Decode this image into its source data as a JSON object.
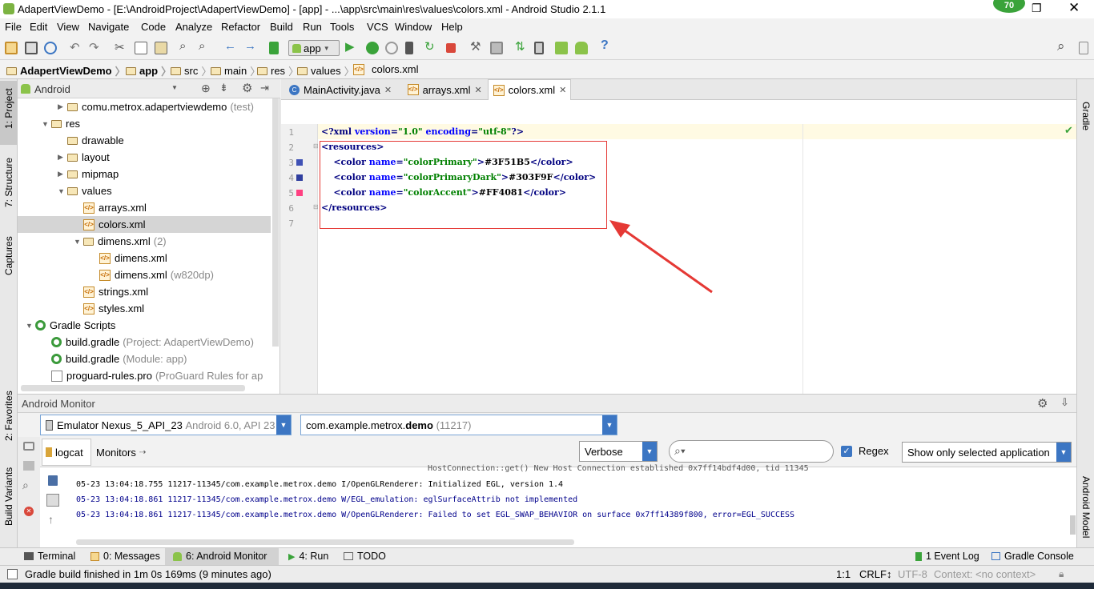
{
  "titlebar": {
    "title": "AdapertViewDemo - [E:\\AndroidProject\\AdapertViewDemo] - [app] - ...\\app\\src\\main\\res\\values\\colors.xml - Android Studio 2.1.1",
    "badge": "70"
  },
  "menu": [
    "File",
    "Edit",
    "View",
    "Navigate",
    "Code",
    "Analyze",
    "Refactor",
    "Build",
    "Run",
    "Tools",
    "VCS",
    "Window",
    "Help"
  ],
  "toolbar": {
    "run_config": "app"
  },
  "breadcrumb": [
    "AdapertViewDemo",
    "app",
    "src",
    "main",
    "res",
    "values",
    "colors.xml"
  ],
  "left_strip": {
    "project": "1: Project",
    "structure": "7: Structure",
    "captures": "Captures",
    "favorites": "2: Favorites",
    "build_variants": "Build Variants"
  },
  "right_strip": {
    "gradle": "Gradle",
    "android_model": "Android Model"
  },
  "project_panel": {
    "view_selector": "Android",
    "tree": [
      {
        "label": "comu.metrox.adapertviewdemo",
        "extra": "(test)",
        "kind": "package",
        "indent": 1,
        "arrow": "right"
      },
      {
        "label": "res",
        "extra": "",
        "kind": "folder",
        "indent": 0,
        "arrow": "down"
      },
      {
        "label": "drawable",
        "extra": "",
        "kind": "folder",
        "indent": 1,
        "arrow": ""
      },
      {
        "label": "layout",
        "extra": "",
        "kind": "folder",
        "indent": 1,
        "arrow": "right"
      },
      {
        "label": "mipmap",
        "extra": "",
        "kind": "folder",
        "indent": 1,
        "arrow": "right"
      },
      {
        "label": "values",
        "extra": "",
        "kind": "folder",
        "indent": 1,
        "arrow": "down"
      },
      {
        "label": "arrays.xml",
        "extra": "",
        "kind": "xml",
        "indent": 2,
        "arrow": ""
      },
      {
        "label": "colors.xml",
        "extra": "",
        "kind": "xml",
        "indent": 2,
        "arrow": "",
        "selected": true
      },
      {
        "label": "dimens.xml",
        "extra": "(2)",
        "kind": "folder",
        "indent": 2,
        "arrow": "down"
      },
      {
        "label": "dimens.xml",
        "extra": "",
        "kind": "xml",
        "indent": 3,
        "arrow": ""
      },
      {
        "label": "dimens.xml",
        "extra": "(w820dp)",
        "kind": "xml",
        "indent": 3,
        "arrow": ""
      },
      {
        "label": "strings.xml",
        "extra": "",
        "kind": "xml",
        "indent": 2,
        "arrow": ""
      },
      {
        "label": "styles.xml",
        "extra": "",
        "kind": "xml",
        "indent": 2,
        "arrow": ""
      },
      {
        "label": "Gradle Scripts",
        "extra": "",
        "kind": "gradle",
        "indent": -1,
        "arrow": "down"
      },
      {
        "label": "build.gradle",
        "extra": "(Project: AdapertViewDemo)",
        "kind": "gradle",
        "indent": 0,
        "arrow": ""
      },
      {
        "label": "build.gradle",
        "extra": "(Module: app)",
        "kind": "gradle",
        "indent": 0,
        "arrow": ""
      },
      {
        "label": "proguard-rules.pro",
        "extra": "(ProGuard Rules for ap",
        "kind": "file",
        "indent": 0,
        "arrow": ""
      }
    ]
  },
  "editor": {
    "tabs": [
      {
        "label": "MainActivity.java",
        "icon": "class-icon"
      },
      {
        "label": "arrays.xml",
        "icon": "xml-file-icon"
      },
      {
        "label": "colors.xml",
        "icon": "xml-file-icon",
        "active": true
      }
    ],
    "line_numbers": [
      "1",
      "2",
      "3",
      "4",
      "5",
      "6",
      "7"
    ],
    "lines": [
      {
        "parts": [
          [
            "tag",
            "<?xml "
          ],
          [
            "attr",
            "version"
          ],
          [
            "tag",
            "="
          ],
          [
            "val",
            "\"1.0\""
          ],
          [
            "tag",
            " "
          ],
          [
            "attr",
            "encoding"
          ],
          [
            "tag",
            "="
          ],
          [
            "val",
            "\"utf-8\""
          ],
          [
            "tag",
            "?>"
          ]
        ]
      },
      {
        "parts": [
          [
            "tag",
            "<resources>"
          ]
        ]
      },
      {
        "parts": [
          [
            "tag",
            "    <color "
          ],
          [
            "attr",
            "name"
          ],
          [
            "tag",
            "="
          ],
          [
            "val",
            "\"colorPrimary\""
          ],
          [
            "tag",
            ">"
          ],
          [
            "plain",
            "#3F51B5"
          ],
          [
            "tag",
            "</color>"
          ]
        ]
      },
      {
        "parts": [
          [
            "tag",
            "    <color "
          ],
          [
            "attr",
            "name"
          ],
          [
            "tag",
            "="
          ],
          [
            "val",
            "\"colorPrimaryDark\""
          ],
          [
            "tag",
            ">"
          ],
          [
            "plain",
            "#303F9F"
          ],
          [
            "tag",
            "</color>"
          ]
        ]
      },
      {
        "parts": [
          [
            "tag",
            "    <color "
          ],
          [
            "attr",
            "name"
          ],
          [
            "tag",
            "="
          ],
          [
            "val",
            "\"colorAccent\""
          ],
          [
            "tag",
            ">"
          ],
          [
            "plain",
            "#FF4081"
          ],
          [
            "tag",
            "</color>"
          ]
        ]
      },
      {
        "parts": [
          [
            "tag",
            "</resources>"
          ]
        ]
      },
      {
        "parts": []
      }
    ],
    "swatches": [
      "#3F51B5",
      "#303F9F",
      "#FF4081"
    ]
  },
  "monitor": {
    "title": "Android Monitor",
    "device": "Emulator Nexus_5_API_23",
    "device_extra": "Android 6.0, API 23",
    "process_prefix": "com.example.metrox.",
    "process_bold": "demo",
    "process_pid": "(11217)",
    "tab_logcat": "logcat",
    "tab_monitors": "Monitors",
    "level": "Verbose",
    "search_placeholder": "",
    "regex_label": "Regex",
    "filter": "Show only selected application",
    "log_lines": [
      "HostConnection::get() New Host Connection established 0x7ff14bdf4d00, tid 11345",
      "05-23 13:04:18.755 11217-11345/com.example.metrox.demo I/OpenGLRenderer: Initialized EGL, version 1.4",
      "05-23 13:04:18.861 11217-11345/com.example.metrox.demo W/EGL_emulation: eglSurfaceAttrib not implemented",
      "05-23 13:04:18.861 11217-11345/com.example.metrox.demo W/OpenGLRenderer: Failed to set EGL_SWAP_BEHAVIOR on surface 0x7ff14389f800, error=EGL_SUCCESS"
    ]
  },
  "bottom_tabs": {
    "terminal": "Terminal",
    "messages": "0: Messages",
    "android_monitor": "6: Android Monitor",
    "run": "4: Run",
    "todo": "TODO",
    "event_log": "1 Event Log",
    "gradle_console": "Gradle Console"
  },
  "status": {
    "message": "Gradle build finished in 1m 0s 169ms (9 minutes ago)",
    "position": "1:1",
    "line_sep": "CRLF↕",
    "encoding": "UTF-8",
    "context": "Context: <no context>"
  },
  "colors": {
    "accent": "#3c76c3",
    "annotation": "#e53935"
  }
}
